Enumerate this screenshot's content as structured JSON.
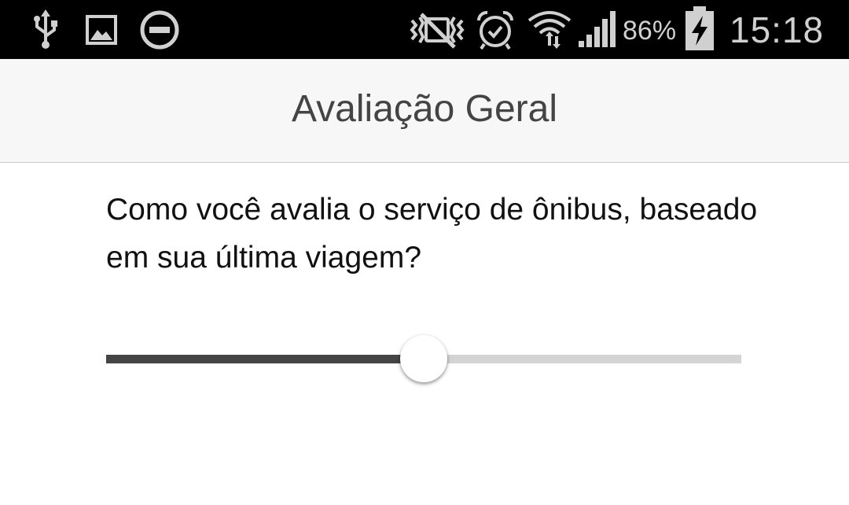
{
  "status_bar": {
    "left_icons": [
      "usb-icon",
      "image-icon",
      "do-not-disturb-icon"
    ],
    "right_icons": [
      "vibrate-icon",
      "alarm-clock-icon",
      "wifi-icon",
      "cellular-signal-icon",
      "battery-charging-icon"
    ],
    "battery_percent": "86%",
    "time": "15:18"
  },
  "app_bar": {
    "title": "Avaliação Geral"
  },
  "main": {
    "question": "Como você avalia o serviço de ônibus, baseado em sua última viagem?",
    "slider": {
      "value": 0.5
    }
  },
  "colors": {
    "status_bar_bg": "#000000",
    "app_bar_bg": "#f7f7f7",
    "track_filled": "#454545",
    "track_empty": "#d4d4d4"
  }
}
